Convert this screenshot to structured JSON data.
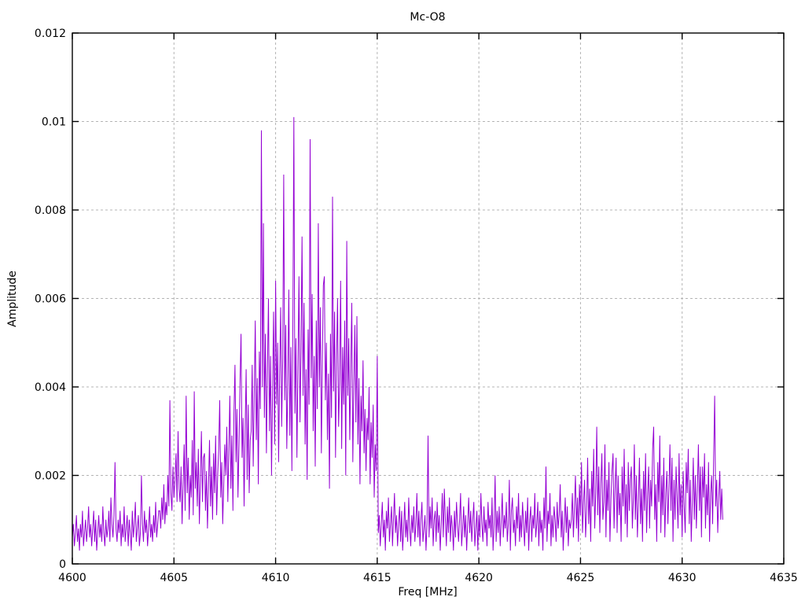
{
  "chart_data": {
    "type": "line",
    "title": "Mc-O8",
    "xlabel": "Freq [MHz]",
    "ylabel": "Amplitude",
    "xlim": [
      4600,
      4635
    ],
    "ylim": [
      0,
      0.012
    ],
    "grid": true,
    "legend": "none",
    "colors": {
      "line": "#9400d3",
      "grid": "#b4b4b4",
      "frame": "#000000",
      "text": "#000000"
    },
    "x_ticks": [
      4600,
      4605,
      4610,
      4615,
      4620,
      4625,
      4630,
      4635
    ],
    "y_ticks": [
      {
        "v": 0,
        "label": "0"
      },
      {
        "v": 0.002,
        "label": "0.002"
      },
      {
        "v": 0.004,
        "label": "0.004"
      },
      {
        "v": 0.006,
        "label": "0.006"
      },
      {
        "v": 0.008,
        "label": "0.008"
      },
      {
        "v": 0.01,
        "label": "0.01"
      },
      {
        "v": 0.012,
        "label": "0.012"
      }
    ],
    "series": [
      {
        "name": "Mc-O8",
        "x_start": 4600.0,
        "x_step": 0.05,
        "x_end": 4632.0,
        "value_scale": 0.0001,
        "values": [
          6,
          9,
          4,
          7,
          11,
          5,
          8,
          3,
          9,
          6,
          12,
          4,
          7,
          10,
          5,
          8,
          13,
          6,
          9,
          4,
          8,
          12,
          5,
          10,
          3,
          7,
          11,
          6,
          9,
          5,
          13,
          7,
          4,
          10,
          6,
          8,
          12,
          5,
          15,
          9,
          6,
          11,
          23,
          8,
          5,
          10,
          7,
          12,
          4,
          9,
          6,
          13,
          5,
          8,
          11,
          4,
          10,
          7,
          3,
          12,
          6,
          9,
          14,
          5,
          8,
          11,
          4,
          7,
          20,
          9,
          5,
          12,
          7,
          10,
          4,
          8,
          13,
          6,
          9,
          5,
          11,
          7,
          14,
          6,
          9,
          12,
          12,
          8,
          15,
          10,
          18,
          9,
          14,
          11,
          20,
          13,
          37,
          16,
          12,
          22,
          15,
          19,
          25,
          14,
          30,
          17,
          14,
          22,
          9,
          18,
          27,
          12,
          38,
          16,
          24,
          10,
          20,
          15,
          28,
          11,
          39,
          17,
          23,
          13,
          26,
          9,
          19,
          30,
          14,
          24,
          25,
          12,
          21,
          8,
          17,
          28,
          13,
          22,
          10,
          25,
          16,
          29,
          11,
          20,
          26,
          37,
          15,
          23,
          9,
          18,
          27,
          20,
          31,
          14,
          26,
          38,
          17,
          29,
          12,
          34,
          45,
          23,
          35,
          15,
          27,
          41,
          52,
          24,
          33,
          13,
          30,
          44,
          19,
          36,
          16,
          28,
          30,
          45,
          22,
          38,
          55,
          28,
          42,
          18,
          48,
          35,
          98,
          40,
          77,
          33,
          52,
          25,
          44,
          60,
          30,
          47,
          20,
          39,
          57,
          27,
          64,
          36,
          50,
          23,
          43,
          58,
          31,
          46,
          88,
          37,
          54,
          26,
          41,
          62,
          29,
          49,
          21,
          56,
          101,
          34,
          51,
          24,
          45,
          65,
          32,
          48,
          74,
          38,
          59,
          27,
          44,
          19,
          53,
          36,
          96,
          42,
          61,
          30,
          47,
          22,
          55,
          35,
          77,
          40,
          58,
          25,
          45,
          63,
          65,
          37,
          50,
          28,
          43,
          17,
          52,
          33,
          83,
          39,
          57,
          24,
          46,
          60,
          31,
          41,
          64,
          26,
          49,
          36,
          55,
          20,
          73,
          38,
          51,
          28,
          44,
          59,
          23,
          40,
          54,
          32,
          56,
          27,
          42,
          18,
          38,
          30,
          46,
          25,
          35,
          21,
          33,
          28,
          40,
          18,
          32,
          24,
          36,
          15,
          27,
          21,
          47,
          7,
          11,
          4,
          9,
          14,
          6,
          10,
          3,
          12,
          8,
          15,
          5,
          9,
          13,
          4,
          10,
          16,
          7,
          11,
          4,
          9,
          13,
          5,
          12,
          3,
          8,
          14,
          6,
          10,
          5,
          15,
          8,
          4,
          11,
          7,
          13,
          5,
          9,
          16,
          6,
          12,
          4,
          10,
          14,
          5,
          8,
          11,
          3,
          9,
          29,
          6,
          13,
          8,
          15,
          4,
          10,
          12,
          5,
          14,
          7,
          11,
          3,
          9,
          16,
          6,
          17,
          10,
          4,
          13,
          7,
          15,
          5,
          11,
          8,
          3,
          12,
          6,
          14,
          9,
          5,
          10,
          16,
          4,
          8,
          13,
          6,
          11,
          3,
          9,
          15,
          7,
          12,
          5,
          10,
          14,
          4,
          8,
          12,
          3,
          11,
          6,
          16,
          9,
          5,
          13,
          7,
          10,
          4,
          14,
          8,
          11,
          6,
          15,
          3,
          9,
          20,
          5,
          12,
          7,
          13,
          4,
          10,
          16,
          6,
          11,
          8,
          14,
          5,
          9,
          19,
          3,
          12,
          15,
          7,
          10,
          4,
          13,
          8,
          16,
          5,
          11,
          6,
          14,
          9,
          4,
          12,
          7,
          15,
          3,
          10,
          13,
          5,
          11,
          8,
          16,
          6,
          9,
          14,
          4,
          12,
          7,
          10,
          3,
          15,
          8,
          22,
          5,
          12,
          9,
          16,
          4,
          11,
          6,
          13,
          10,
          5,
          14,
          8,
          11,
          18,
          6,
          12,
          3,
          9,
          15,
          7,
          13,
          4,
          10,
          8,
          10,
          16,
          6,
          13,
          20,
          8,
          15,
          5,
          18,
          11,
          23,
          7,
          14,
          19,
          6,
          12,
          24,
          9,
          17,
          5,
          21,
          13,
          26,
          8,
          16,
          31,
          11,
          22,
          7,
          18,
          25,
          10,
          14,
          27,
          6,
          19,
          12,
          23,
          5,
          15,
          21,
          25,
          8,
          17,
          24,
          7,
          20,
          11,
          16,
          5,
          22,
          13,
          26,
          9,
          18,
          6,
          23,
          12,
          19,
          22,
          8,
          15,
          27,
          10,
          20,
          6,
          14,
          24,
          9,
          17,
          5,
          21,
          12,
          25,
          7,
          16,
          22,
          8,
          19,
          13,
          26,
          31,
          10,
          18,
          5,
          23,
          14,
          29,
          7,
          20,
          11,
          24,
          6,
          16,
          21,
          9,
          17,
          27,
          12,
          24,
          5,
          19,
          10,
          22,
          15,
          8,
          25,
          11,
          18,
          6,
          21,
          13,
          7,
          23,
          16,
          26,
          9,
          19,
          5,
          14,
          24,
          10,
          20,
          8,
          17,
          27,
          12,
          22,
          6,
          22,
          15,
          25,
          8,
          18,
          11,
          23,
          5,
          16,
          20,
          9,
          24,
          38,
          13,
          19,
          7,
          15,
          21,
          10,
          17,
          10
        ]
      }
    ]
  }
}
